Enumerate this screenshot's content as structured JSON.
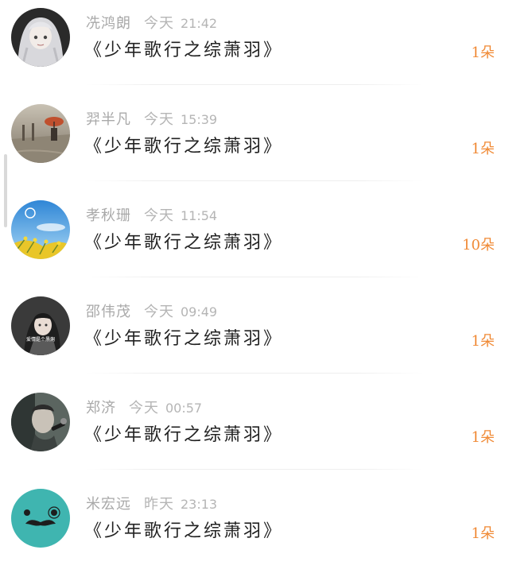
{
  "items": [
    {
      "user": "冼鸿朗",
      "day": "今天",
      "time": "21:42",
      "title": "《少年歌行之综萧羽》",
      "count": "1朵",
      "avatar": "anime-girl-avatar"
    },
    {
      "user": "羿半凡",
      "day": "今天",
      "time": "15:39",
      "title": "《少年歌行之综萧羽》",
      "count": "1朵",
      "avatar": "rainy-street-avatar"
    },
    {
      "user": "孝秋珊",
      "day": "今天",
      "time": "11:54",
      "title": "《少年歌行之综萧羽》",
      "count": "10朵",
      "avatar": "sky-flowers-avatar"
    },
    {
      "user": "邵伟茂",
      "day": "今天",
      "time": "09:49",
      "title": "《少年歌行之综萧羽》",
      "count": "1朵",
      "avatar": "portrait-with-caption-avatar"
    },
    {
      "user": "郑济",
      "day": "今天",
      "time": "00:57",
      "title": "《少年歌行之综萧羽》",
      "count": "1朵",
      "avatar": "singer-microphone-avatar"
    },
    {
      "user": "米宏远",
      "day": "昨天",
      "time": "23:13",
      "title": "《少年歌行之综萧羽》",
      "count": "1朵",
      "avatar": "mustache-cartoon-avatar"
    }
  ],
  "avatar4_caption": "爱情是个黑洞",
  "colors": {
    "count": "#f08a36",
    "meta": "#b5b5b5",
    "title": "#222222"
  }
}
